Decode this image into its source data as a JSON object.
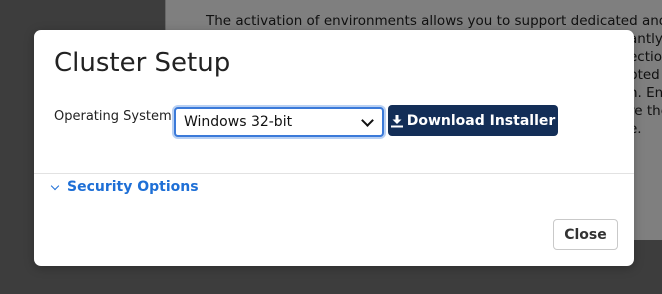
{
  "background": {
    "lines": [
      "The activation of environments allows you to support dedicated and separa",
      "antly",
      "ectio",
      "pted",
      "n. En",
      "re the",
      "e."
    ]
  },
  "modal": {
    "title": "Cluster Setup",
    "os_label": "Operating System",
    "os_select": {
      "value": "Windows 32-bit"
    },
    "download_button": {
      "label": "Download Installer",
      "icon": "download-icon"
    },
    "security_toggle": {
      "label": "Security Options",
      "icon": "chevron-down-icon"
    },
    "close_button": {
      "label": "Close"
    }
  },
  "colors": {
    "primary_button": "#132e57",
    "link": "#1e6fd6",
    "focus_ring": "#3b7ad9"
  }
}
